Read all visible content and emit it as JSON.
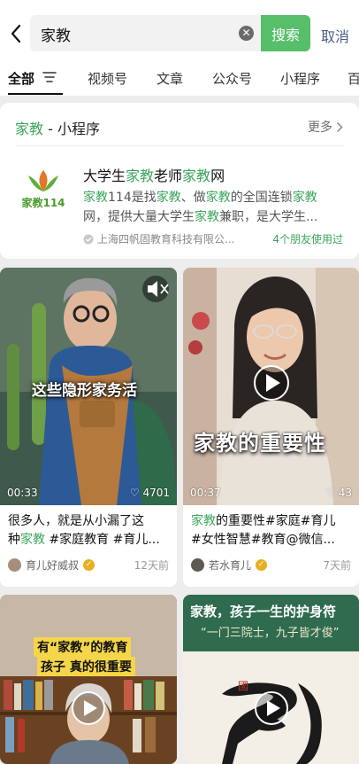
{
  "search": {
    "query": "家教",
    "button_label": "搜索",
    "cancel_label": "取消"
  },
  "tabs": [
    {
      "label": "全部",
      "active": true
    },
    {
      "label": "视频号"
    },
    {
      "label": "文章"
    },
    {
      "label": "公众号"
    },
    {
      "label": "小程序"
    },
    {
      "label": "百"
    }
  ],
  "mini_program": {
    "section_keyword": "家教",
    "section_suffix": " - 小程序",
    "more_label": "更多",
    "logo_text": "家教114",
    "name_parts": [
      "大学生",
      "家教",
      "老师",
      "家教",
      "网"
    ],
    "desc_line1_parts": [
      "家教",
      "114是找",
      "家教",
      "、做",
      "家教",
      "的全国连锁",
      "家教"
    ],
    "desc_line2_parts": [
      "网，提供大量大学生",
      "家教",
      "兼职，是大学生..."
    ],
    "org": "上海四帆固教育科技有限公...",
    "friends": "4个朋友使用过"
  },
  "videos": [
    {
      "duration": "00:33",
      "likes": "4701",
      "overlay_text": "这些隐形家务活",
      "title_line1": "很多人，就是从小漏了这",
      "title_line2_parts": [
        "种",
        "家教",
        " #家庭教育 #育儿..."
      ],
      "author": "育儿好威叔",
      "time": "12天前"
    },
    {
      "duration": "00:37",
      "likes": "43",
      "overlay_text": "家教的重要性",
      "title_line1_parts": [
        "家教",
        "的重要性#家庭#育儿"
      ],
      "title_line2": "#女性智慧#教育@微信...",
      "author": "若水育儿",
      "time": "7天前"
    },
    {
      "overlay_text_1": "有“家教”的教育",
      "overlay_text_2": "孩子 真的很重要"
    },
    {
      "overlay_text_1": "家教，孩子一生的护身符",
      "overlay_text_2": "“一门三院士，九子皆才俊”",
      "stamp_char": "國"
    }
  ],
  "colors": {
    "accent_green": "#57be6a",
    "highlight_green": "#3ba55c",
    "link_blue": "#4a5f86",
    "background": "#ededed"
  }
}
